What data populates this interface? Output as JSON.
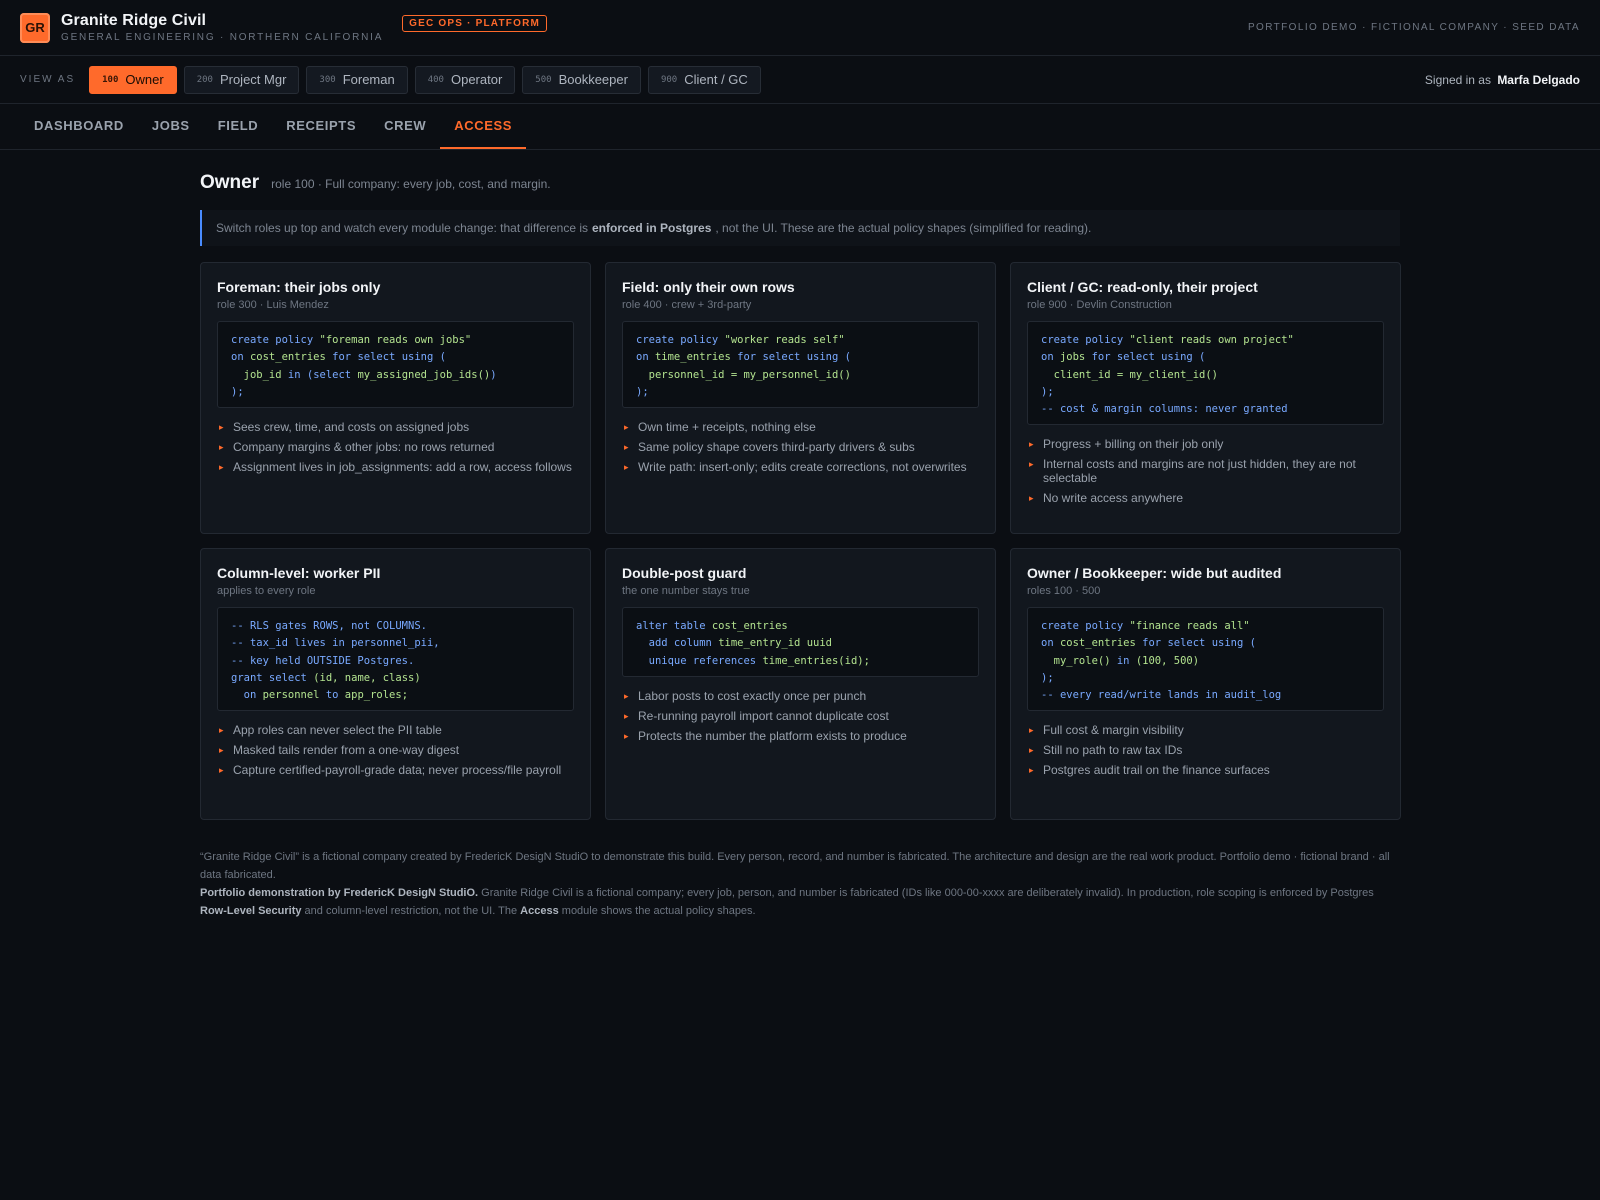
{
  "header": {
    "logo_text": "GR",
    "company": "Granite Ridge Civil",
    "tagline": "GENERAL ENGINEERING · NORTHERN CALIFORNIA",
    "badge": "GEC OPS · PLATFORM",
    "right_note": "PORTFOLIO DEMO · FICTIONAL COMPANY · SEED DATA"
  },
  "rolebar": {
    "label": "VIEW AS",
    "roles": [
      {
        "code": "100",
        "name": "Owner",
        "active": true
      },
      {
        "code": "200",
        "name": "Project Mgr",
        "active": false
      },
      {
        "code": "300",
        "name": "Foreman",
        "active": false
      },
      {
        "code": "400",
        "name": "Operator",
        "active": false
      },
      {
        "code": "500",
        "name": "Bookkeeper",
        "active": false
      },
      {
        "code": "900",
        "name": "Client / GC",
        "active": false
      }
    ],
    "signed_in_prefix": "Signed in as",
    "signed_in_user": "Marfa Delgado"
  },
  "tabs": [
    {
      "label": "DASHBOARD",
      "active": false
    },
    {
      "label": "JOBS",
      "active": false
    },
    {
      "label": "FIELD",
      "active": false
    },
    {
      "label": "RECEIPTS",
      "active": false
    },
    {
      "label": "CREW",
      "active": false
    },
    {
      "label": "ACCESS",
      "active": true
    }
  ],
  "page": {
    "title": "Owner",
    "subtitle": "role 100 · Full company: every job, cost, and margin.",
    "callout_pre": "Switch roles up top and watch every module change: that difference is",
    "callout_bold": "enforced in Postgres",
    "callout_post": ", not the UI. These are the actual policy shapes (simplified for reading)."
  },
  "cards": [
    {
      "title": "Foreman: their jobs only",
      "subtitle": "role 300 · Luis Mendez",
      "code": [
        [
          [
            "kw",
            "create policy "
          ],
          [
            "str",
            "\"foreman reads own jobs\""
          ]
        ],
        [
          [
            "kw",
            "on "
          ],
          [
            "str",
            "cost_entries "
          ],
          [
            "kw",
            "for select using ("
          ]
        ],
        [
          [
            "str",
            "  job_id "
          ],
          [
            "kw",
            "in ("
          ],
          [
            "kw",
            "select "
          ],
          [
            "str",
            "my_assigned_job_ids()"
          ],
          [
            "kw",
            ")"
          ]
        ],
        [
          [
            "kw",
            ");"
          ]
        ]
      ],
      "bullets": [
        "Sees crew, time, and costs on assigned jobs",
        "Company margins & other jobs: no rows returned",
        "Assignment lives in job_assignments: add a row, access follows"
      ]
    },
    {
      "title": "Field: only their own rows",
      "subtitle": "role 400 · crew + 3rd-party",
      "code": [
        [
          [
            "kw",
            "create policy "
          ],
          [
            "str",
            "\"worker reads self\""
          ]
        ],
        [
          [
            "kw",
            "on "
          ],
          [
            "str",
            "time_entries "
          ],
          [
            "kw",
            "for select using ("
          ]
        ],
        [
          [
            "str",
            "  personnel_id = my_personnel_id()"
          ]
        ],
        [
          [
            "kw",
            ");"
          ]
        ]
      ],
      "bullets": [
        "Own time + receipts, nothing else",
        "Same policy shape covers third-party drivers & subs",
        "Write path: insert-only; edits create corrections, not overwrites"
      ]
    },
    {
      "title": "Client / GC: read-only, their project",
      "subtitle": "role 900 · Devlin Construction",
      "code": [
        [
          [
            "kw",
            "create policy "
          ],
          [
            "str",
            "\"client reads own project\""
          ]
        ],
        [
          [
            "kw",
            "on "
          ],
          [
            "str",
            "jobs "
          ],
          [
            "kw",
            "for select using ("
          ]
        ],
        [
          [
            "str",
            "  client_id = my_client_id()"
          ]
        ],
        [
          [
            "kw",
            ");"
          ]
        ],
        [
          [
            "cm",
            "-- cost & margin columns: never granted"
          ]
        ]
      ],
      "bullets": [
        "Progress + billing on their job only",
        "Internal costs and margins are not just hidden, they are not selectable",
        "No write access anywhere"
      ]
    },
    {
      "title": "Column-level: worker PII",
      "subtitle": "applies to every role",
      "code": [
        [
          [
            "cm",
            "-- RLS gates ROWS, not COLUMNS."
          ]
        ],
        [
          [
            "cm",
            "-- tax_id lives in personnel_pii,"
          ]
        ],
        [
          [
            "cm",
            "-- key held OUTSIDE Postgres."
          ]
        ],
        [
          [
            "kw",
            "grant select "
          ],
          [
            "str",
            "(id, name, class)"
          ]
        ],
        [
          [
            "kw",
            "  on "
          ],
          [
            "str",
            "personnel "
          ],
          [
            "kw",
            "to "
          ],
          [
            "str",
            "app_roles;"
          ]
        ]
      ],
      "bullets": [
        "App roles can never select the PII table",
        "Masked tails render from a one-way digest",
        "Capture certified-payroll-grade data; never process/file payroll"
      ]
    },
    {
      "title": "Double-post guard",
      "subtitle": "the one number stays true",
      "code": [
        [
          [
            "kw",
            "alter table "
          ],
          [
            "str",
            "cost_entries"
          ]
        ],
        [
          [
            "kw",
            "  add column "
          ],
          [
            "str",
            "time_entry_id uuid"
          ]
        ],
        [
          [
            "kw",
            "  unique references "
          ],
          [
            "str",
            "time_entries(id);"
          ]
        ]
      ],
      "bullets": [
        "Labor posts to cost exactly once per punch",
        "Re-running payroll import cannot duplicate cost",
        "Protects the number the platform exists to produce"
      ]
    },
    {
      "title": "Owner / Bookkeeper: wide but audited",
      "subtitle": "roles 100 · 500",
      "code": [
        [
          [
            "kw",
            "create policy "
          ],
          [
            "str",
            "\"finance reads all\""
          ]
        ],
        [
          [
            "kw",
            "on "
          ],
          [
            "str",
            "cost_entries "
          ],
          [
            "kw",
            "for select using ("
          ]
        ],
        [
          [
            "str",
            "  my_role() "
          ],
          [
            "kw",
            "in "
          ],
          [
            "str",
            "(100, 500)"
          ]
        ],
        [
          [
            "kw",
            ");"
          ]
        ],
        [
          [
            "cm",
            "-- every read/write lands in audit_log"
          ]
        ]
      ],
      "bullets": [
        "Full cost & margin visibility",
        "Still no path to raw tax IDs",
        "Postgres audit trail on the finance surfaces"
      ]
    }
  ],
  "footer": {
    "line1": "“Granite Ridge Civil” is a fictional company created by FredericK DesigN StudiO to demonstrate this build. Every person, record, and number is fabricated. The architecture and design are the real work product. Portfolio demo · fictional brand · all data fabricated.",
    "bold1": "Portfolio demonstration by FredericK DesigN StudiO.",
    "text2": " Granite Ridge Civil is a fictional company; every job, person, and number is fabricated (IDs like 000-00-xxxx are deliberately invalid). In production, role scoping is enforced by Postgres ",
    "bold2": "Row-Level Security",
    "text3": " and column-level restriction, not the UI. The ",
    "bold3": "Access",
    "text4": " module shows the actual policy shapes."
  },
  "colors": {
    "accent": "#ff6a2b",
    "background": "#0b0e13",
    "card": "#12171e",
    "callout_border": "#4a8cff",
    "code_keyword": "#79a9ff",
    "code_string": "#b3e38f"
  }
}
